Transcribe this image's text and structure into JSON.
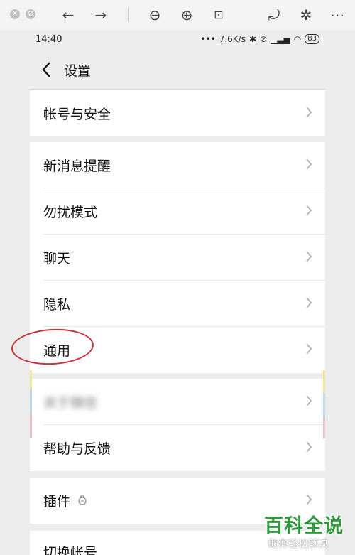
{
  "viewer_toolbar": {
    "buttons": [
      "close",
      "minimize",
      "back",
      "forward",
      "zoom-out",
      "zoom-in",
      "fit",
      "rotate",
      "magic",
      "more"
    ]
  },
  "status_bar": {
    "time": "14:40",
    "dots": "•••",
    "speed": "7.6K/s",
    "battery": "83"
  },
  "nav": {
    "title": "设置"
  },
  "groups": [
    {
      "items": [
        {
          "label": "帐号与安全"
        }
      ]
    },
    {
      "items": [
        {
          "label": "新消息提醒"
        },
        {
          "label": "勿扰模式"
        },
        {
          "label": "聊天"
        },
        {
          "label": "隐私"
        },
        {
          "label": "通用"
        }
      ]
    },
    {
      "items": [
        {
          "label": "关于微信"
        },
        {
          "label": "帮助与反馈"
        }
      ]
    },
    {
      "items": [
        {
          "label": "插件"
        }
      ]
    },
    {
      "items": [
        {
          "label": "切换帐号"
        }
      ]
    }
  ],
  "watermark": {
    "title": "百科全说",
    "subtitle": "助你轻松解决"
  },
  "colors": {
    "highlight": "#c8323c",
    "watermark_green": "#2e9a3b"
  }
}
